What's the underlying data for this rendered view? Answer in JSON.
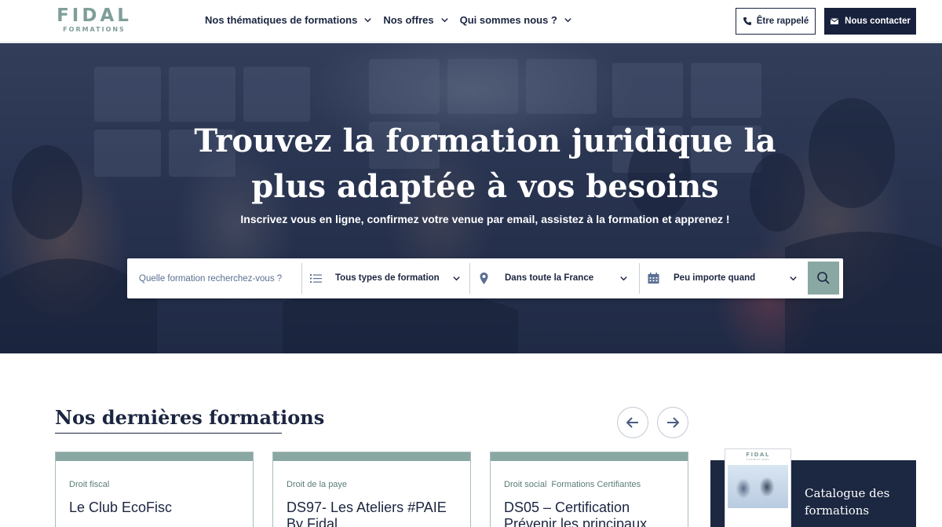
{
  "header": {
    "logo_main": "FIDAL",
    "logo_sub": "FORMATIONS",
    "nav": [
      {
        "label": "Nos thématiques de formations"
      },
      {
        "label": "Nos offres"
      },
      {
        "label": "Qui sommes nous ?"
      }
    ],
    "callback_label": "Être rappelé",
    "contact_label": "Nous contacter"
  },
  "hero": {
    "title_line1": "Trouvez la formation juridique la",
    "title_line2": "plus adaptée à vos besoins",
    "subtitle": "Inscrivez vous en ligne, confirmez votre venue par email, assistez à la formation et apprenez !"
  },
  "search": {
    "placeholder": "Quelle formation recherchez-vous ?",
    "type_value": "Tous types de formation",
    "location_value": "Dans toute la France",
    "date_value": "Peu importe quand"
  },
  "section": {
    "title": "Nos dernières formations"
  },
  "cards": [
    {
      "tags": [
        "Droit fiscal"
      ],
      "title": "Le Club EcoFisc"
    },
    {
      "tags": [
        "Droit de la paye"
      ],
      "title": "DS97- Les Ateliers #PAIE By Fidal"
    },
    {
      "tags": [
        "Droit social",
        "Formations Certifiantes"
      ],
      "title": "DS05 – Certification Prévenir les principaux"
    }
  ],
  "catalogue": {
    "cover_logo": "FIDAL",
    "cover_logo_sub": "FORMATIONS",
    "text": "Catalogue des formations"
  },
  "colors": {
    "navy": "#1b2540",
    "sage": "#8aa8a3",
    "logo": "#7f9e99"
  }
}
